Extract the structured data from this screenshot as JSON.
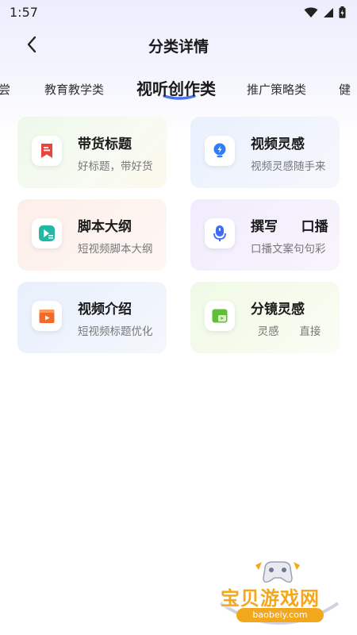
{
  "status": {
    "time": "1:57"
  },
  "header": {
    "title": "分类详情"
  },
  "tabs": [
    {
      "label": "尝",
      "active": false
    },
    {
      "label": "教育教学类",
      "active": false
    },
    {
      "label": "视听创作类",
      "active": true
    },
    {
      "label": "推广策略类",
      "active": false
    },
    {
      "label": "健",
      "active": false
    }
  ],
  "cards": [
    {
      "title": "带货标题",
      "subtitle": "好标题，带好货",
      "icon": "bookmark-icon",
      "accent": "#e8453c"
    },
    {
      "title": "视频灵感",
      "subtitle": "视频灵感随手来",
      "icon": "lightbulb-icon",
      "accent": "#2f7df6"
    },
    {
      "title": "脚本大纲",
      "subtitle": "短视频脚本大纲",
      "icon": "video-script-icon",
      "accent": "#23b8a4"
    },
    {
      "title": "撰写     口播",
      "subtitle": "口播文案句句彩",
      "icon": "microphone-icon",
      "accent": "#3d6cf0"
    },
    {
      "title": "视频介绍",
      "subtitle": "短视频标题优化",
      "icon": "clapperboard-icon",
      "accent": "#f26a2a"
    },
    {
      "title": "分镜灵感",
      "subtitle": "  灵感      直接",
      "icon": "storyboard-icon",
      "accent": "#62bd3a"
    }
  ],
  "watermark": {
    "text": "宝贝游戏网",
    "url": "baobeiy.com"
  }
}
